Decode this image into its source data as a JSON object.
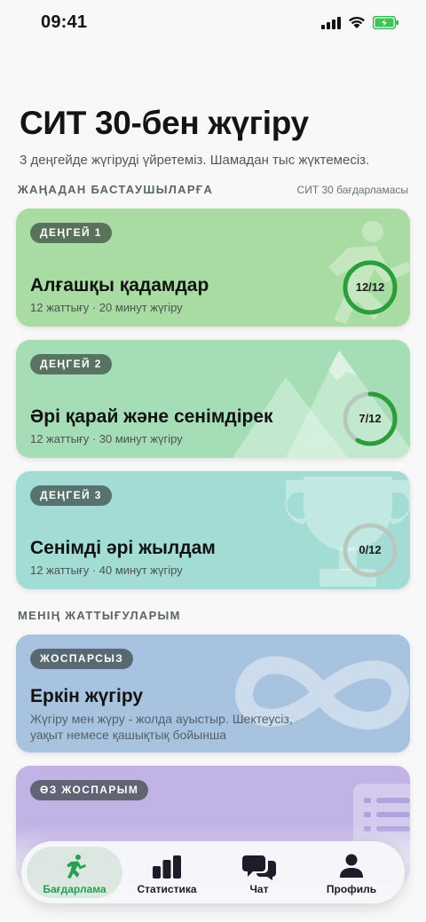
{
  "status": {
    "time": "09:41"
  },
  "header": {
    "title": "СИТ 30-бен жүгіру",
    "subtitle": "3 деңгейде жүгіруді үйретеміз. Шамадан тыс жүктемесіз."
  },
  "sections": {
    "beginners": {
      "label": "ЖАҢАДАН БАСТАУШЫЛАРҒА",
      "right": "СИТ 30 бағдарламасы"
    },
    "my": {
      "label": "МЕНІҢ ЖАТТЫҒУЛАРЫМ"
    }
  },
  "levels": [
    {
      "badge": "ДЕҢГЕЙ 1",
      "title": "Алғашқы қадамдар",
      "meta": "12 жаттығу · 20 минут жүгіру",
      "progress_label": "12/12",
      "progress": 1.0,
      "bg": "#a8dca2",
      "ring_color": "#2b9e3c",
      "icon": "runner-icon"
    },
    {
      "badge": "ДЕҢГЕЙ 2",
      "title": "Әрі қарай және сенімдірек",
      "meta": "12 жаттығу · 30 минут жүгіру",
      "progress_label": "7/12",
      "progress": 0.583,
      "bg": "#a5ddb6",
      "ring_color": "#2b9e3c",
      "icon": "mountains-icon"
    },
    {
      "badge": "ДЕҢГЕЙ 3",
      "title": "Сенімді әрі жылдам",
      "meta": "12 жаттығу · 40 минут жүгіру",
      "progress_label": "0/12",
      "progress": 0.0,
      "bg": "#a2dcd5",
      "ring_color": "#2b9e3c",
      "icon": "trophy-icon"
    }
  ],
  "custom": [
    {
      "badge": "ЖОСПАРСЫЗ",
      "title": "Еркін жүгіру",
      "desc": "Жүгіру мен жүру - жолда ауыстыр. Шектеусіз, уақыт немесе қашықтық бойынша",
      "bg": "#a8c3e0",
      "icon": "infinity-icon"
    },
    {
      "badge": "ӨЗ ЖОСПАРЫМ",
      "bg": "#c1b3e6",
      "icon": "list-icon"
    }
  ],
  "tabs": [
    {
      "label": "Бағдарлама",
      "icon": "runner-icon",
      "active": true
    },
    {
      "label": "Статистика",
      "icon": "bar-chart-icon",
      "active": false
    },
    {
      "label": "Чат",
      "icon": "chat-icon",
      "active": false
    },
    {
      "label": "Профиль",
      "icon": "person-icon",
      "active": false
    }
  ],
  "colors": {
    "accent": "#26a052",
    "ring_track": "#b9c8bf"
  }
}
